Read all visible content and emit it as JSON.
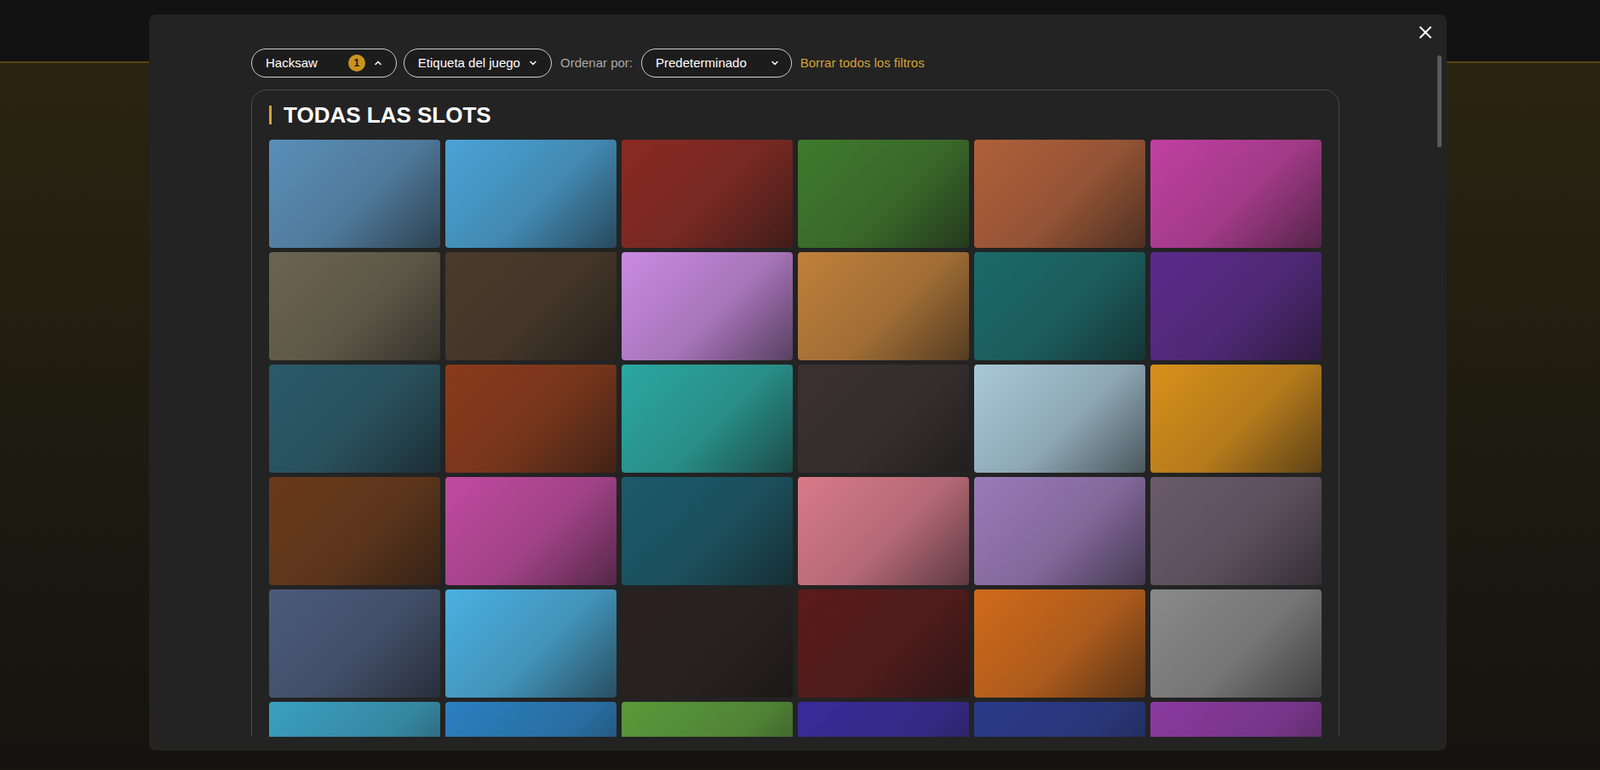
{
  "filters": [
    {
      "label": "Hacksaw",
      "badge": "1",
      "expanded": true
    },
    {
      "label": "Etiqueta del juego",
      "expanded": false
    }
  ],
  "sort": {
    "label": "Ordenar por:",
    "value": "Predeterminado",
    "expanded": false
  },
  "clear_filters": "Borrar todos los filtros",
  "section": {
    "title": "TODAS LAS SLOTS"
  },
  "tiles": [
    {
      "color": "#5a8fb8"
    },
    {
      "color": "#4aa3d6"
    },
    {
      "color": "#8a2a22"
    },
    {
      "color": "#3f7a2c"
    },
    {
      "color": "#b0603a"
    },
    {
      "color": "#c040a0"
    },
    {
      "color": "#6b6450"
    },
    {
      "color": "#4a3a2a"
    },
    {
      "color": "#c98ae0"
    },
    {
      "color": "#c0803a"
    },
    {
      "color": "#1a6a6a"
    },
    {
      "color": "#5a2a8a"
    },
    {
      "color": "#2a5a6a"
    },
    {
      "color": "#8a3a1a"
    },
    {
      "color": "#2aa8a0"
    },
    {
      "color": "#3a3030"
    },
    {
      "color": "#a8c8d8"
    },
    {
      "color": "#d8901a"
    },
    {
      "color": "#6a3a1a"
    },
    {
      "color": "#c04aa0"
    },
    {
      "color": "#1a5a6a"
    },
    {
      "color": "#d87a8a"
    },
    {
      "color": "#9a7ab8"
    },
    {
      "color": "#6a5a6a"
    },
    {
      "color": "#4a5a7a"
    },
    {
      "color": "#4ab0e0"
    },
    {
      "color": "#2a2020"
    },
    {
      "color": "#5a1a1a"
    },
    {
      "color": "#d06a1a"
    },
    {
      "color": "#8a8a8a"
    },
    {
      "color": "#3aa0c0"
    },
    {
      "color": "#2a80c0"
    },
    {
      "color": "#5a9a3a"
    },
    {
      "color": "#3a2a9a"
    },
    {
      "color": "#2a3a8a"
    },
    {
      "color": "#8a3aa0"
    }
  ]
}
